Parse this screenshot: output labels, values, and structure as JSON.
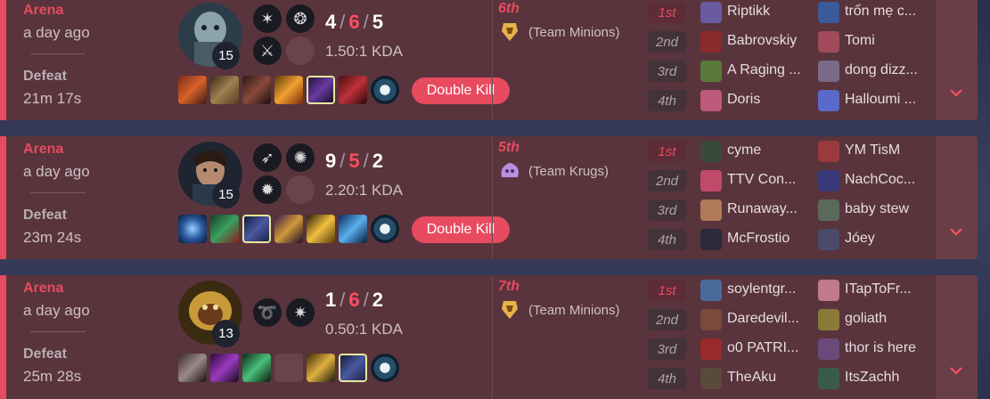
{
  "matches": [
    {
      "mode": "Arena",
      "time_ago": "a day ago",
      "result": "Defeat",
      "duration": "21m 17s",
      "champion_level": "15",
      "kills": "4",
      "deaths": "6",
      "assists": "5",
      "kda_ratio": "1.50:1 KDA",
      "badge": "Double Kill",
      "placement": "6th",
      "team": "(Team Minions)",
      "team_icon": "minion-crest-icon",
      "players": [
        {
          "rank": "1st",
          "left": "Riptikk",
          "right": "trốn mẹ c..."
        },
        {
          "rank": "2nd",
          "left": "Babrovskiy",
          "right": "Tomi"
        },
        {
          "rank": "3rd",
          "left": "A Raging ...",
          "right": "dong dizz..."
        },
        {
          "rank": "4th",
          "left": "Doris",
          "right": "Halloumi ..."
        }
      ]
    },
    {
      "mode": "Arena",
      "time_ago": "a day ago",
      "result": "Defeat",
      "duration": "23m 24s",
      "champion_level": "15",
      "kills": "9",
      "deaths": "5",
      "assists": "2",
      "kda_ratio": "2.20:1 KDA",
      "badge": "Double Kill",
      "placement": "5th",
      "team": "(Team Krugs)",
      "team_icon": "krug-crest-icon",
      "players": [
        {
          "rank": "1st",
          "left": "cyme",
          "right": "YM TisM"
        },
        {
          "rank": "2nd",
          "left": "TTV Con...",
          "right": "NachCoc..."
        },
        {
          "rank": "3rd",
          "left": "Runaway...",
          "right": "baby stew"
        },
        {
          "rank": "4th",
          "left": "McFrostio",
          "right": "Jóey"
        }
      ]
    },
    {
      "mode": "Arena",
      "time_ago": "a day ago",
      "result": "Defeat",
      "duration": "25m 28s",
      "champion_level": "13",
      "kills": "1",
      "deaths": "6",
      "assists": "2",
      "kda_ratio": "0.50:1 KDA",
      "badge": "",
      "placement": "7th",
      "team": "(Team Minions)",
      "team_icon": "minion-crest-icon",
      "players": [
        {
          "rank": "1st",
          "left": "soylentgr...",
          "right": "ITapToFr..."
        },
        {
          "rank": "2nd",
          "left": "Daredevil...",
          "right": "goliath"
        },
        {
          "rank": "3rd",
          "left": "o0 PATRI...",
          "right": "thor is here"
        },
        {
          "rank": "4th",
          "left": "TheAku",
          "right": "ItsZachh"
        }
      ]
    }
  ],
  "colors": {
    "card_bg": "#59343c",
    "defeat_accent": "#e84a5f",
    "expand_bg": "#6a3e47"
  }
}
